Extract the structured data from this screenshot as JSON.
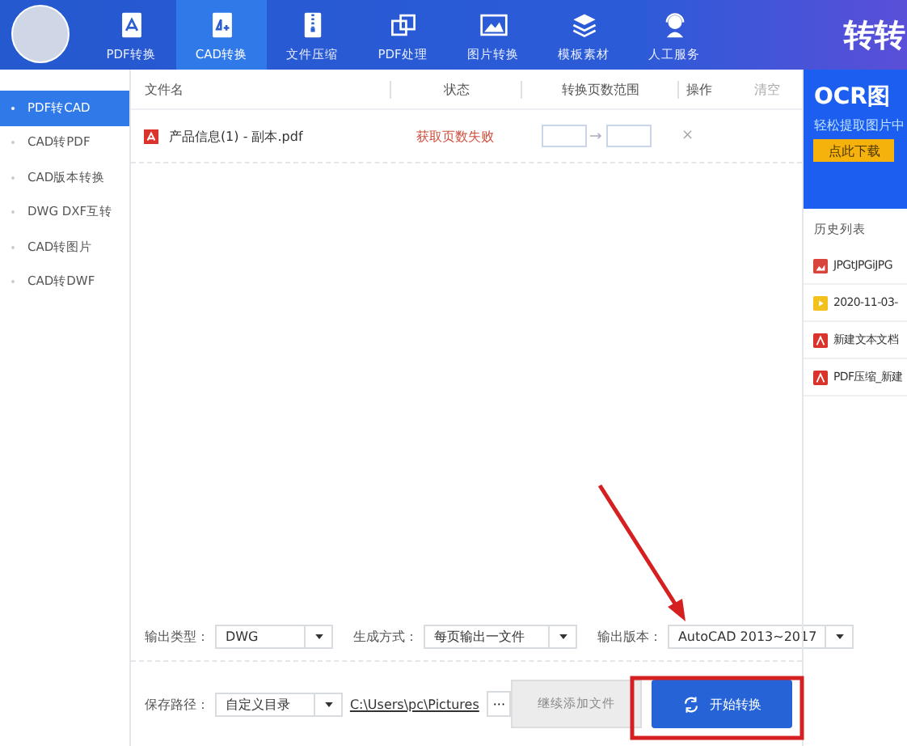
{
  "topbar": {
    "tabs": [
      {
        "label": "PDF转换",
        "kind": "pdf",
        "selected": false
      },
      {
        "label": "CAD转换",
        "kind": "cad",
        "selected": true
      },
      {
        "label": "文件压缩",
        "kind": "zip",
        "selected": false
      },
      {
        "label": "PDF处理",
        "kind": "squares",
        "selected": false
      },
      {
        "label": "图片转换",
        "kind": "image",
        "selected": false
      },
      {
        "label": "模板素材",
        "kind": "layers",
        "selected": false
      },
      {
        "label": "人工服务",
        "kind": "headset",
        "selected": false
      }
    ],
    "logo": "转转"
  },
  "sidebar": {
    "items": [
      {
        "label": "PDF转CAD",
        "selected": true
      },
      {
        "label": "CAD转PDF",
        "selected": false
      },
      {
        "label": "CAD版本转换",
        "selected": false
      },
      {
        "label": "DWG DXF互转",
        "selected": false
      },
      {
        "label": "CAD转图片",
        "selected": false
      },
      {
        "label": "CAD转DWF",
        "selected": false
      }
    ]
  },
  "table": {
    "columns": [
      "文件名",
      "状态",
      "转换页数范围",
      "操作"
    ],
    "clear": "清空",
    "rows": [
      {
        "name": "产品信息(1) - 副本.pdf",
        "status": "获取页数失败",
        "delete": "×"
      }
    ]
  },
  "options": [
    {
      "label": "输出类型：",
      "value": "DWG"
    },
    {
      "label": "生成方式：",
      "value": "每页输出一文件"
    },
    {
      "label": "输出版本：",
      "value": "AutoCAD 2013~2017"
    }
  ],
  "save": {
    "label": "保存路径：",
    "mode": "自定义目录",
    "path": "C:\\Users\\pc\\Pictures",
    "browse": "···"
  },
  "buttons": {
    "add": "继续添加文件",
    "start": "开始转换"
  },
  "ad": {
    "title": "OCR图",
    "subtitle": "轻松提取图片中",
    "button": "点此下载"
  },
  "history": {
    "title": "历史列表",
    "items": [
      {
        "name": "JPGtJPGiJPG",
        "kind": "image"
      },
      {
        "name": "2020-11-03-",
        "kind": "video"
      },
      {
        "name": "新建文本文档",
        "kind": "pdf"
      },
      {
        "name": "PDF压缩_新建",
        "kind": "pdf"
      }
    ]
  }
}
